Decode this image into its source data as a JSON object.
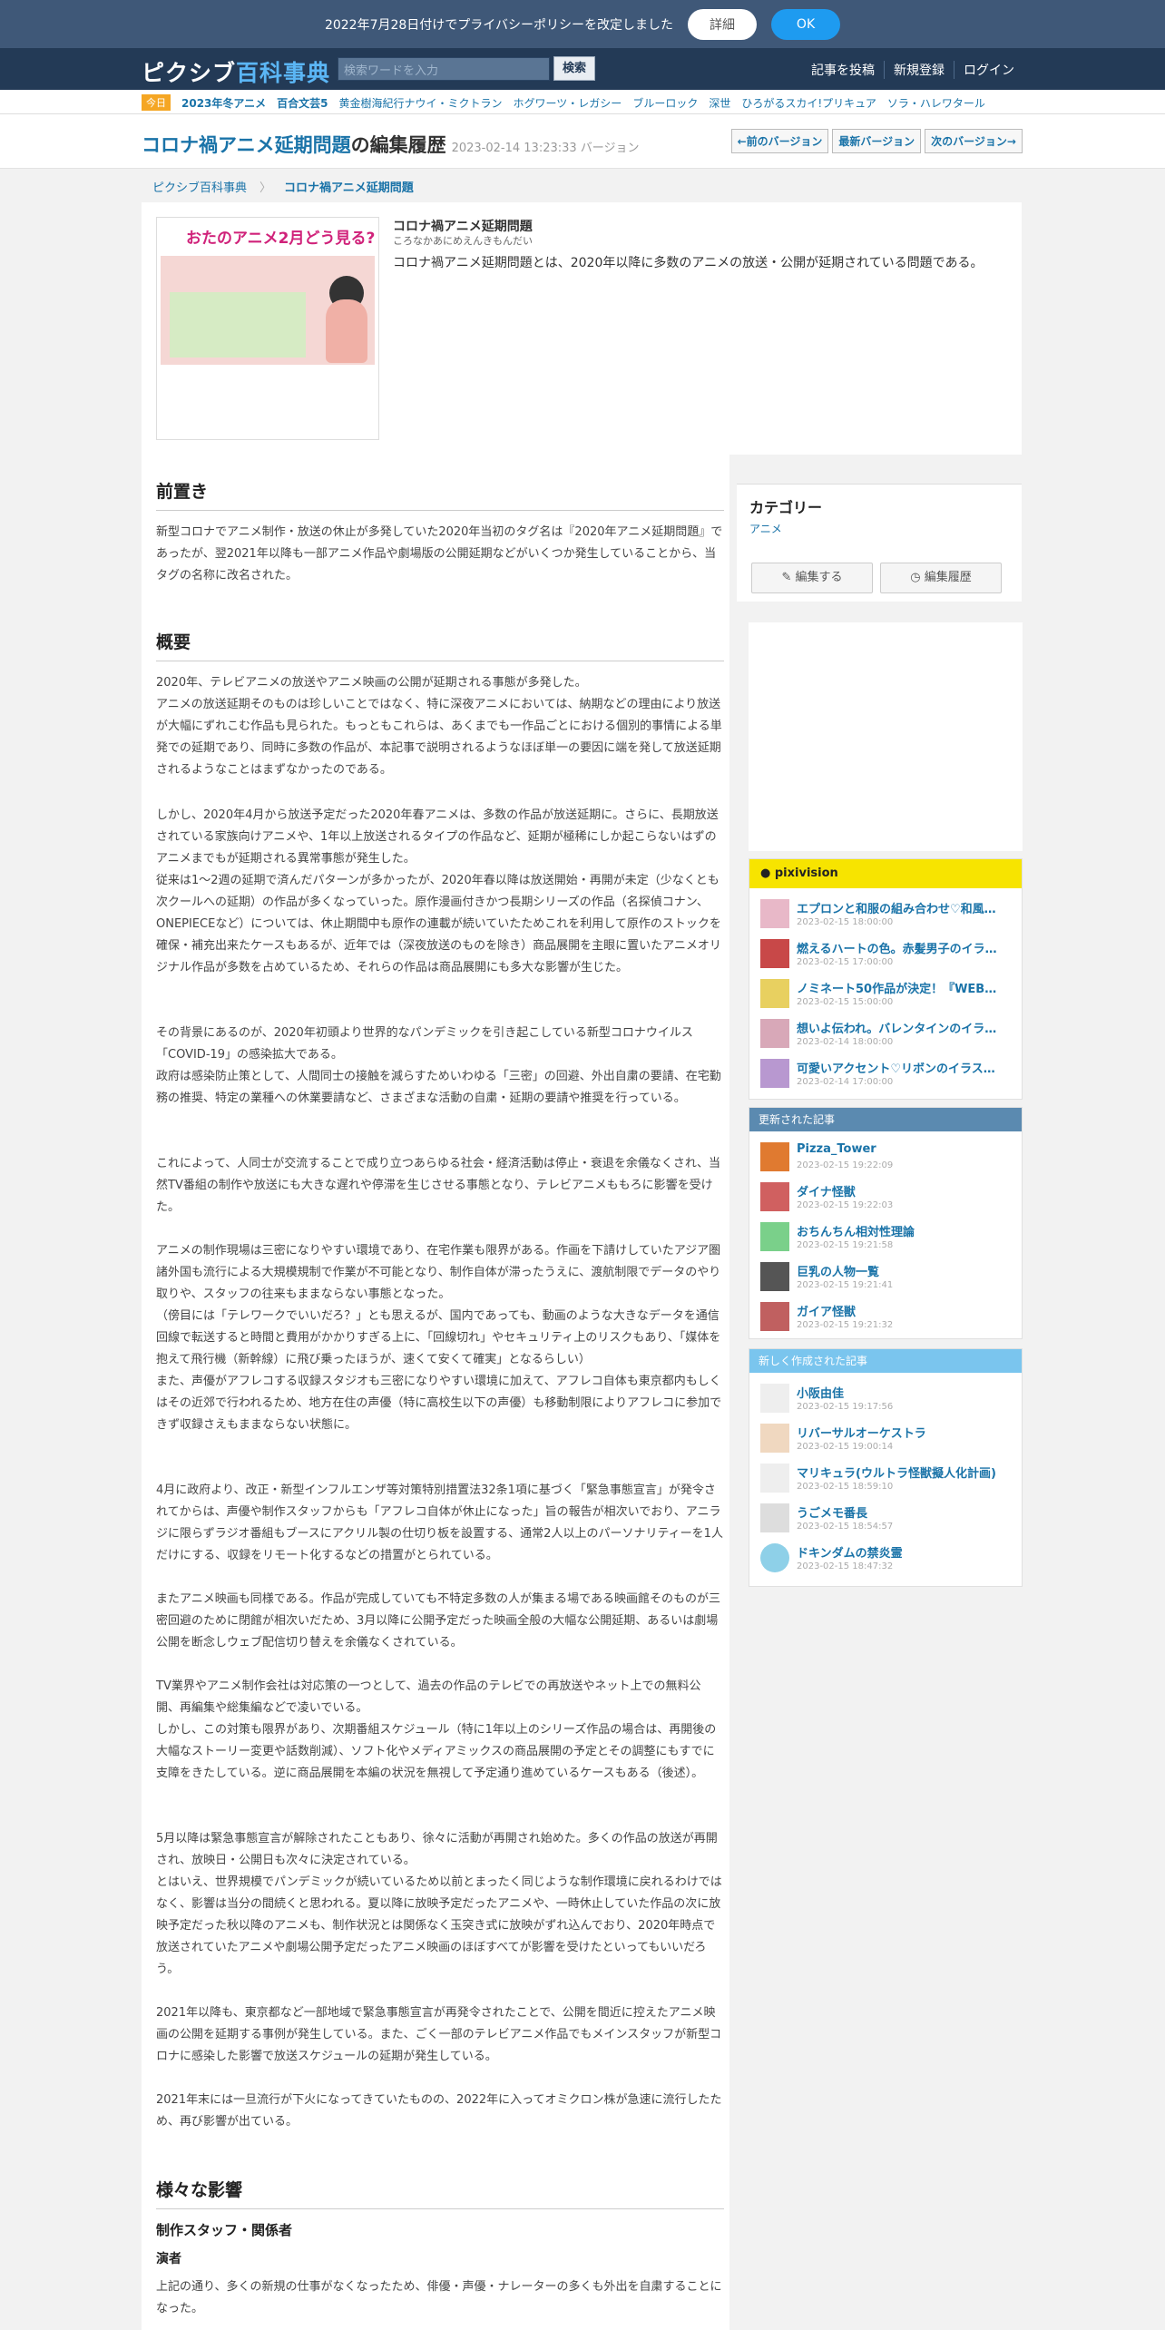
{
  "privacy": {
    "text": "2022年7月28日付けでプライバシーポリシーを改定しました",
    "details": "詳細",
    "ok": "OK"
  },
  "header": {
    "logo_a": "ピクシブ",
    "logo_b": "百科事典",
    "search_placeholder": "検索ワードを入力",
    "search_btn": "検索",
    "nav": [
      "記事を投稿",
      "新規登録",
      "ログイン"
    ]
  },
  "trend": {
    "today": "今日",
    "items": [
      "2023年冬アニメ",
      "百合文芸5",
      "黄金樹海紀行ナウイ・ミクトラン",
      "ホグワーツ・レガシー",
      "ブルーロック",
      "深世",
      "ひろがるスカイ!プリキュア",
      "ソラ・ハレワタール"
    ]
  },
  "title": {
    "link": "コロナ禍アニメ延期問題",
    "suffix": "の編集履歴",
    "version": "2023-02-14 13:23:33 バージョン",
    "nav": [
      "←前のバージョン",
      "最新バージョン",
      "次のバージョン→"
    ]
  },
  "breadcrumb": [
    "ピクシブ百科事典",
    "コロナ禍アニメ延期問題"
  ],
  "summary": {
    "thumb_text": "おたのアニメ2月どう見る?",
    "title": "コロナ禍アニメ延期問題",
    "reading": "ころなかあにめえんきもんだい",
    "desc": "コロナ禍アニメ延期問題とは、2020年以降に多数のアニメの放送・公開が延期されている問題である。"
  },
  "article": {
    "h_intro": "前置き",
    "intro": "新型コロナでアニメ制作・放送の休止が多発していた2020年当初のタグ名は『2020年アニメ延期問題』であったが、翌2021年以降も一部アニメ作品や劇場版の公開延期などがいくつか発生していることから、当タグの名称に改名された。",
    "h_overview": "概要",
    "p1": "2020年、テレビアニメの放送やアニメ映画の公開が延期される事態が多発した。",
    "p2": "アニメの放送延期そのものは珍しいことではなく、特に深夜アニメにおいては、納期などの理由により放送が大幅にずれこむ作品も見られた。もっともこれらは、あくまでも一作品ごとにおける個別的事情による単発での延期であり、同時に多数の作品が、本記事で説明されるようなほぼ単一の要因に端を発して放送延期されるようなことはまずなかったのである。",
    "p3": "しかし、2020年4月から放送予定だった2020年春アニメは、多数の作品が放送延期に。さらに、長期放送されている家族向けアニメや、1年以上放送されるタイプの作品など、延期が極稀にしか起こらないはずのアニメまでもが延期される異常事態が発生した。",
    "p4": "従来は1～2週の延期で済んだパターンが多かったが、2020年春以降は放送開始・再開が未定（少なくとも次クールへの延期）の作品が多くなっていった。原作漫画付きかつ長期シリーズの作品（名探偵コナン、ONEPIECEなど）については、休止期間中も原作の連載が続いていたためこれを利用して原作のストックを確保・補充出来たケースもあるが、近年では（深夜放送のものを除き）商品展開を主眼に置いたアニメオリジナル作品が多数を占めているため、それらの作品は商品展開にも多大な影響が生じた。",
    "p5": "その背景にあるのが、2020年初頭より世界的なパンデミックを引き起こしている新型コロナウイルス「COVID-19」の感染拡大である。",
    "p6": "政府は感染防止策として、人間同士の接触を減らすためいわゆる「三密」の回避、外出自粛の要請、在宅勤務の推奨、特定の業種への休業要請など、さまざまな活動の自粛・延期の要請や推奨を行っている。",
    "p7": "これによって、人同士が交流することで成り立つあらゆる社会・経済活動は停止・衰退を余儀なくされ、当然TV番組の制作や放送にも大きな遅れや停滞を生じさせる事態となり、テレビアニメももろに影響を受けた。",
    "p8": "アニメの制作現場は三密になりやすい環境であり、在宅作業も限界がある。作画を下請けしていたアジア圏諸外国も流行による大規模規制で作業が不可能となり、制作自体が滞ったうえに、渡航制限でデータのやり取りや、スタッフの往来もままならない事態となった。",
    "p9": "（傍目には「テレワークでいいだろ？」とも思えるが、国内であっても、動画のような大きなデータを通信回線で転送すると時間と費用がかかりすぎる上に、「回線切れ」やセキュリティ上のリスクもあり、「媒体を抱えて飛行機（新幹線）に飛び乗ったほうが、速くて安くて確実」となるらしい）",
    "p10": "また、声優がアフレコする収録スタジオも三密になりやすい環境に加えて、アフレコ自体も東京都内もしくはその近郊で行われるため、地方在住の声優（特に高校生以下の声優）も移動制限によりアフレコに参加できず収録さえもままならない状態に。",
    "p11": "4月に政府より、改正・新型インフルエンザ等対策特別措置法32条1項に基づく「緊急事態宣言」が発令されてからは、声優や制作スタッフからも「アフレコ自体が休止になった」旨の報告が相次いでおり、アニラジに限らずラジオ番組もブースにアクリル製の仕切り板を設置する、通常2人以上のパーソナリティーを1人だけにする、収録をリモート化するなどの措置がとられている。",
    "p12": "またアニメ映画も同様である。作品が完成していても不特定多数の人が集まる場である映画館そのものが三密回避のために閉館が相次いだため、3月以降に公開予定だった映画全般の大幅な公開延期、あるいは劇場公開を断念しウェブ配信切り替えを余儀なくされている。",
    "p13": "TV業界やアニメ制作会社は対応策の一つとして、過去の作品のテレビでの再放送やネット上での無料公開、再編集や総集編などで凌いでいる。",
    "p14": "しかし、この対策も限界があり、次期番組スケジュール（特に1年以上のシリーズ作品の場合は、再開後の大幅なストーリー変更や話数削減）、ソフト化やメディアミックスの商品展開の予定とその調整にもすでに支障をきたしている。逆に商品展開を本編の状況を無視して予定通り進めているケースもある（後述）。",
    "p15": "5月以降は緊急事態宣言が解除されたこともあり、徐々に活動が再開され始めた。多くの作品の放送が再開され、放映日・公開日も次々に決定されている。",
    "p16": "とはいえ、世界規模でパンデミックが続いているため以前とまったく同じような制作環境に戻れるわけではなく、影響は当分の間続くと思われる。夏以降に放映予定だったアニメや、一時休止していた作品の次に放映予定だった秋以降のアニメも、制作状況とは関係なく玉突き式に放映がずれ込んでおり、2020年時点で放送されていたアニメや劇場公開予定だったアニメ映画のほぼすべてが影響を受けたといってもいいだろう。",
    "p17": "2021年以降も、東京都など一部地域で緊急事態宣言が再発令されたことで、公開を間近に控えたアニメ映画の公開を延期する事例が発生している。また、ごく一部のテレビアニメ作品でもメインスタッフが新型コロナに感染した影響で放送スケジュールの延期が発生している。",
    "p18": "2021年末には一旦流行が下火になってきていたものの、2022年に入ってオミクロン株が急速に流行したため、再び影響が出ている。",
    "h_impact": "様々な影響",
    "h_staff": "制作スタッフ・関係者",
    "h_perf": "演者",
    "p19": "上記の通り、多くの新規の仕事がなくなったため、俳優・声優・ナレーターの多くも外出を自粛することになった。"
  },
  "sidebar": {
    "cat_title": "カテゴリー",
    "cat_value": "アニメ",
    "edit": "編集する",
    "history": "編集履歴",
    "pixiv_title": "pixivision",
    "pixiv": [
      {
        "t": "エプロンと和服の組み合わせ♡和風…",
        "d": "2023-02-15 18:00:00"
      },
      {
        "t": "燃えるハートの色。赤髪男子のイラ…",
        "d": "2023-02-15 17:00:00"
      },
      {
        "t": "ノミネート50作品が決定！『WEB…",
        "d": "2023-02-15 15:00:00"
      },
      {
        "t": "想いよ伝われ。バレンタインのイラ…",
        "d": "2023-02-14 18:00:00"
      },
      {
        "t": "可愛いアクセント♡リボンのイラス…",
        "d": "2023-02-14 17:00:00"
      }
    ],
    "updated_title": "更新された記事",
    "updated": [
      {
        "t": "Pizza_Tower",
        "d": "2023-02-15 19:22:09"
      },
      {
        "t": "ダイナ怪獣",
        "d": "2023-02-15 19:22:03"
      },
      {
        "t": "おちんちん相対性理論",
        "d": "2023-02-15 19:21:58"
      },
      {
        "t": "巨乳の人物一覧",
        "d": "2023-02-15 19:21:41"
      },
      {
        "t": "ガイア怪獣",
        "d": "2023-02-15 19:21:32"
      }
    ],
    "new_title": "新しく作成された記事",
    "new": [
      {
        "t": "小阪由佳",
        "d": "2023-02-15 19:17:56"
      },
      {
        "t": "リバーサルオーケストラ",
        "d": "2023-02-15 19:00:14"
      },
      {
        "t": "マリキュラ(ウルトラ怪獣擬人化計画)",
        "d": "2023-02-15 18:59:10"
      },
      {
        "t": "うごメモ番長",
        "d": "2023-02-15 18:54:57"
      },
      {
        "t": "ドキンダムの禁炎霊",
        "d": "2023-02-15 18:47:32"
      }
    ]
  }
}
